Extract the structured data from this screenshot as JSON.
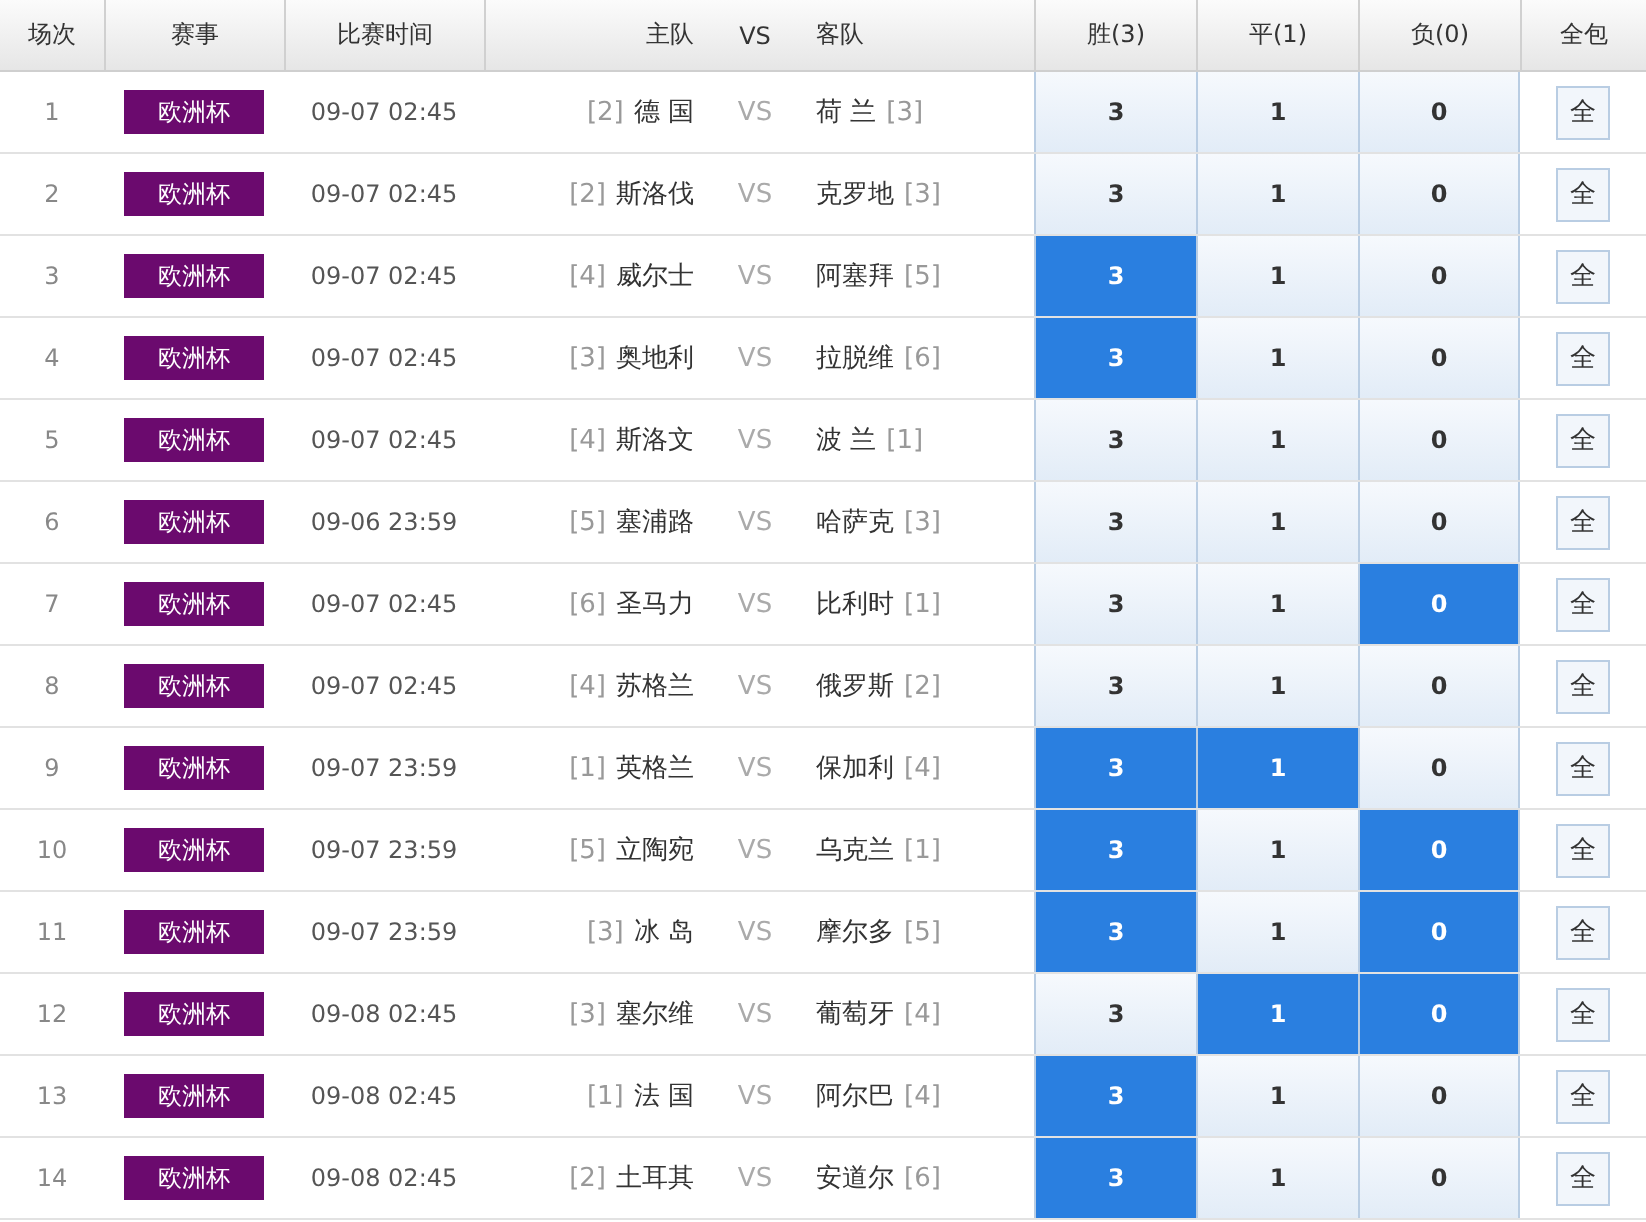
{
  "columns": [
    "场次",
    "赛事",
    "比赛时间",
    "主队",
    "VS",
    "客队",
    "胜(3)",
    "平(1)",
    "负(0)",
    "全包"
  ],
  "rows": [
    {
      "no": "1",
      "league": "欧洲杯",
      "time": "09-07 02:45",
      "home_rank": "[2]",
      "home": "德 国",
      "vs": "VS",
      "away": "荷 兰",
      "away_rank": "[3]",
      "options": [
        {
          "value": "3",
          "selected": false
        },
        {
          "value": "1",
          "selected": false
        },
        {
          "value": "0",
          "selected": false
        }
      ],
      "all": "全"
    },
    {
      "no": "2",
      "league": "欧洲杯",
      "time": "09-07 02:45",
      "home_rank": "[2]",
      "home": "斯洛伐",
      "vs": "VS",
      "away": "克罗地",
      "away_rank": "[3]",
      "options": [
        {
          "value": "3",
          "selected": false
        },
        {
          "value": "1",
          "selected": false
        },
        {
          "value": "0",
          "selected": false
        }
      ],
      "all": "全"
    },
    {
      "no": "3",
      "league": "欧洲杯",
      "time": "09-07 02:45",
      "home_rank": "[4]",
      "home": "威尔士",
      "vs": "VS",
      "away": "阿塞拜",
      "away_rank": "[5]",
      "options": [
        {
          "value": "3",
          "selected": true
        },
        {
          "value": "1",
          "selected": false
        },
        {
          "value": "0",
          "selected": false
        }
      ],
      "all": "全"
    },
    {
      "no": "4",
      "league": "欧洲杯",
      "time": "09-07 02:45",
      "home_rank": "[3]",
      "home": "奥地利",
      "vs": "VS",
      "away": "拉脱维",
      "away_rank": "[6]",
      "options": [
        {
          "value": "3",
          "selected": true
        },
        {
          "value": "1",
          "selected": false
        },
        {
          "value": "0",
          "selected": false
        }
      ],
      "all": "全"
    },
    {
      "no": "5",
      "league": "欧洲杯",
      "time": "09-07 02:45",
      "home_rank": "[4]",
      "home": "斯洛文",
      "vs": "VS",
      "away": "波 兰",
      "away_rank": "[1]",
      "options": [
        {
          "value": "3",
          "selected": false
        },
        {
          "value": "1",
          "selected": false
        },
        {
          "value": "0",
          "selected": false
        }
      ],
      "all": "全"
    },
    {
      "no": "6",
      "league": "欧洲杯",
      "time": "09-06 23:59",
      "home_rank": "[5]",
      "home": "塞浦路",
      "vs": "VS",
      "away": "哈萨克",
      "away_rank": "[3]",
      "options": [
        {
          "value": "3",
          "selected": false
        },
        {
          "value": "1",
          "selected": false
        },
        {
          "value": "0",
          "selected": false
        }
      ],
      "all": "全"
    },
    {
      "no": "7",
      "league": "欧洲杯",
      "time": "09-07 02:45",
      "home_rank": "[6]",
      "home": "圣马力",
      "vs": "VS",
      "away": "比利时",
      "away_rank": "[1]",
      "options": [
        {
          "value": "3",
          "selected": false
        },
        {
          "value": "1",
          "selected": false
        },
        {
          "value": "0",
          "selected": true
        }
      ],
      "all": "全"
    },
    {
      "no": "8",
      "league": "欧洲杯",
      "time": "09-07 02:45",
      "home_rank": "[4]",
      "home": "苏格兰",
      "vs": "VS",
      "away": "俄罗斯",
      "away_rank": "[2]",
      "options": [
        {
          "value": "3",
          "selected": false
        },
        {
          "value": "1",
          "selected": false
        },
        {
          "value": "0",
          "selected": false
        }
      ],
      "all": "全"
    },
    {
      "no": "9",
      "league": "欧洲杯",
      "time": "09-07 23:59",
      "home_rank": "[1]",
      "home": "英格兰",
      "vs": "VS",
      "away": "保加利",
      "away_rank": "[4]",
      "options": [
        {
          "value": "3",
          "selected": true
        },
        {
          "value": "1",
          "selected": true
        },
        {
          "value": "0",
          "selected": false
        }
      ],
      "all": "全"
    },
    {
      "no": "10",
      "league": "欧洲杯",
      "time": "09-07 23:59",
      "home_rank": "[5]",
      "home": "立陶宛",
      "vs": "VS",
      "away": "乌克兰",
      "away_rank": "[1]",
      "options": [
        {
          "value": "3",
          "selected": true
        },
        {
          "value": "1",
          "selected": false
        },
        {
          "value": "0",
          "selected": true
        }
      ],
      "all": "全"
    },
    {
      "no": "11",
      "league": "欧洲杯",
      "time": "09-07 23:59",
      "home_rank": "[3]",
      "home": "冰 岛",
      "vs": "VS",
      "away": "摩尔多",
      "away_rank": "[5]",
      "options": [
        {
          "value": "3",
          "selected": true
        },
        {
          "value": "1",
          "selected": false
        },
        {
          "value": "0",
          "selected": true
        }
      ],
      "all": "全"
    },
    {
      "no": "12",
      "league": "欧洲杯",
      "time": "09-08 02:45",
      "home_rank": "[3]",
      "home": "塞尔维",
      "vs": "VS",
      "away": "葡萄牙",
      "away_rank": "[4]",
      "options": [
        {
          "value": "3",
          "selected": false
        },
        {
          "value": "1",
          "selected": true
        },
        {
          "value": "0",
          "selected": true
        }
      ],
      "all": "全"
    },
    {
      "no": "13",
      "league": "欧洲杯",
      "time": "09-08 02:45",
      "home_rank": "[1]",
      "home": "法 国",
      "vs": "VS",
      "away": "阿尔巴",
      "away_rank": "[4]",
      "options": [
        {
          "value": "3",
          "selected": true
        },
        {
          "value": "1",
          "selected": false
        },
        {
          "value": "0",
          "selected": false
        }
      ],
      "all": "全"
    },
    {
      "no": "14",
      "league": "欧洲杯",
      "time": "09-08 02:45",
      "home_rank": "[2]",
      "home": "土耳其",
      "vs": "VS",
      "away": "安道尔",
      "away_rank": "[6]",
      "options": [
        {
          "value": "3",
          "selected": true
        },
        {
          "value": "1",
          "selected": false
        },
        {
          "value": "0",
          "selected": false
        }
      ],
      "all": "全"
    }
  ]
}
